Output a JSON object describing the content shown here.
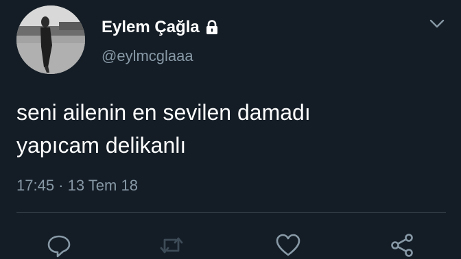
{
  "user": {
    "display_name": "Eylem Çağla",
    "handle": "@eylmcglaaa",
    "protected_icon": "lock-icon",
    "avatar": "profile-photo"
  },
  "tweet": {
    "text_lines": [
      "seni ailenin en sevilen damadı",
      "yapıcam delikanlı"
    ],
    "timestamp": "17:45 · 13 Tem 18"
  },
  "actions": [
    "reply-icon",
    "retweet-icon",
    "like-icon",
    "share-icon"
  ],
  "menu_icon": "chevron-down-icon",
  "colors": {
    "background": "#141d26",
    "text": "#ffffff",
    "secondary_text": "#8899a6",
    "divider": "#38444d"
  }
}
